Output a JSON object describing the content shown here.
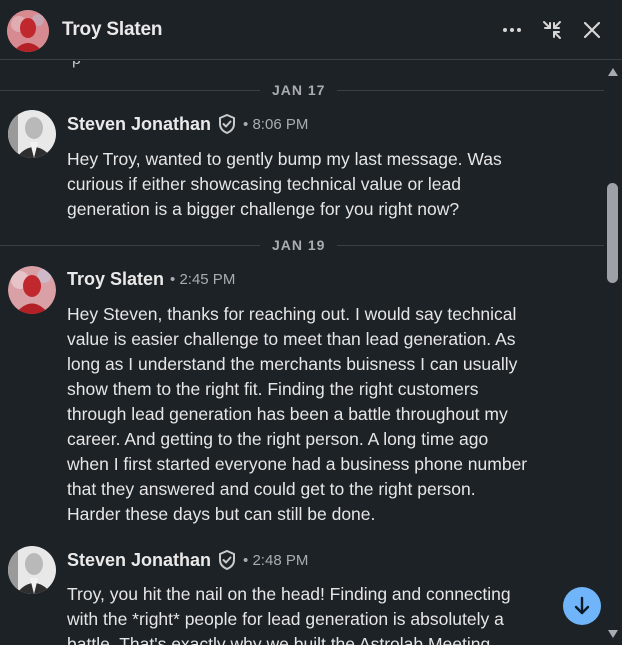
{
  "header": {
    "title": "Troy Slaten",
    "more_icon": "ellipsis-icon",
    "minimize_icon": "collapse-arrows-icon",
    "close_icon": "close-icon"
  },
  "conversation": {
    "partial_text": "p",
    "date_dividers": [
      "JAN 17",
      "JAN 19"
    ],
    "messages": [
      {
        "sender": "Steven Jonathan",
        "verified": true,
        "time": "• 8:06 PM",
        "lines": [
          "Hey Troy, wanted to gently bump my last message. Was",
          "curious if either showcasing technical value or lead",
          "generation is a bigger challenge for you right now?"
        ]
      },
      {
        "sender": "Troy Slaten",
        "verified": false,
        "time": "• 2:45 PM",
        "lines": [
          "Hey Steven, thanks for reaching out. I would say technical",
          "value is easier challenge to meet than lead generation. As",
          "long as I understand the merchants buisness I can usually",
          "show them to the right fit. Finding the right customers",
          "through lead generation has been a battle throughout my",
          "career. And getting to the right person. A long time ago",
          "when I first started everyone had a business phone number",
          "that they answered and could get to the right person.",
          "Harder these days but can still be done."
        ]
      },
      {
        "sender": "Steven Jonathan",
        "verified": true,
        "time": "• 2:48 PM",
        "lines": [
          "Troy, you hit the nail on the head! Finding and connecting",
          "with the *right* people for lead generation is absolutely a",
          "battle. That's exactly why we built the Astrolab Meeting"
        ]
      }
    ]
  },
  "jump_button_icon": "arrow-down-icon",
  "colors": {
    "background": "#1d2226",
    "accent": "#70b5f9",
    "muted_text": "#a9adb1"
  }
}
